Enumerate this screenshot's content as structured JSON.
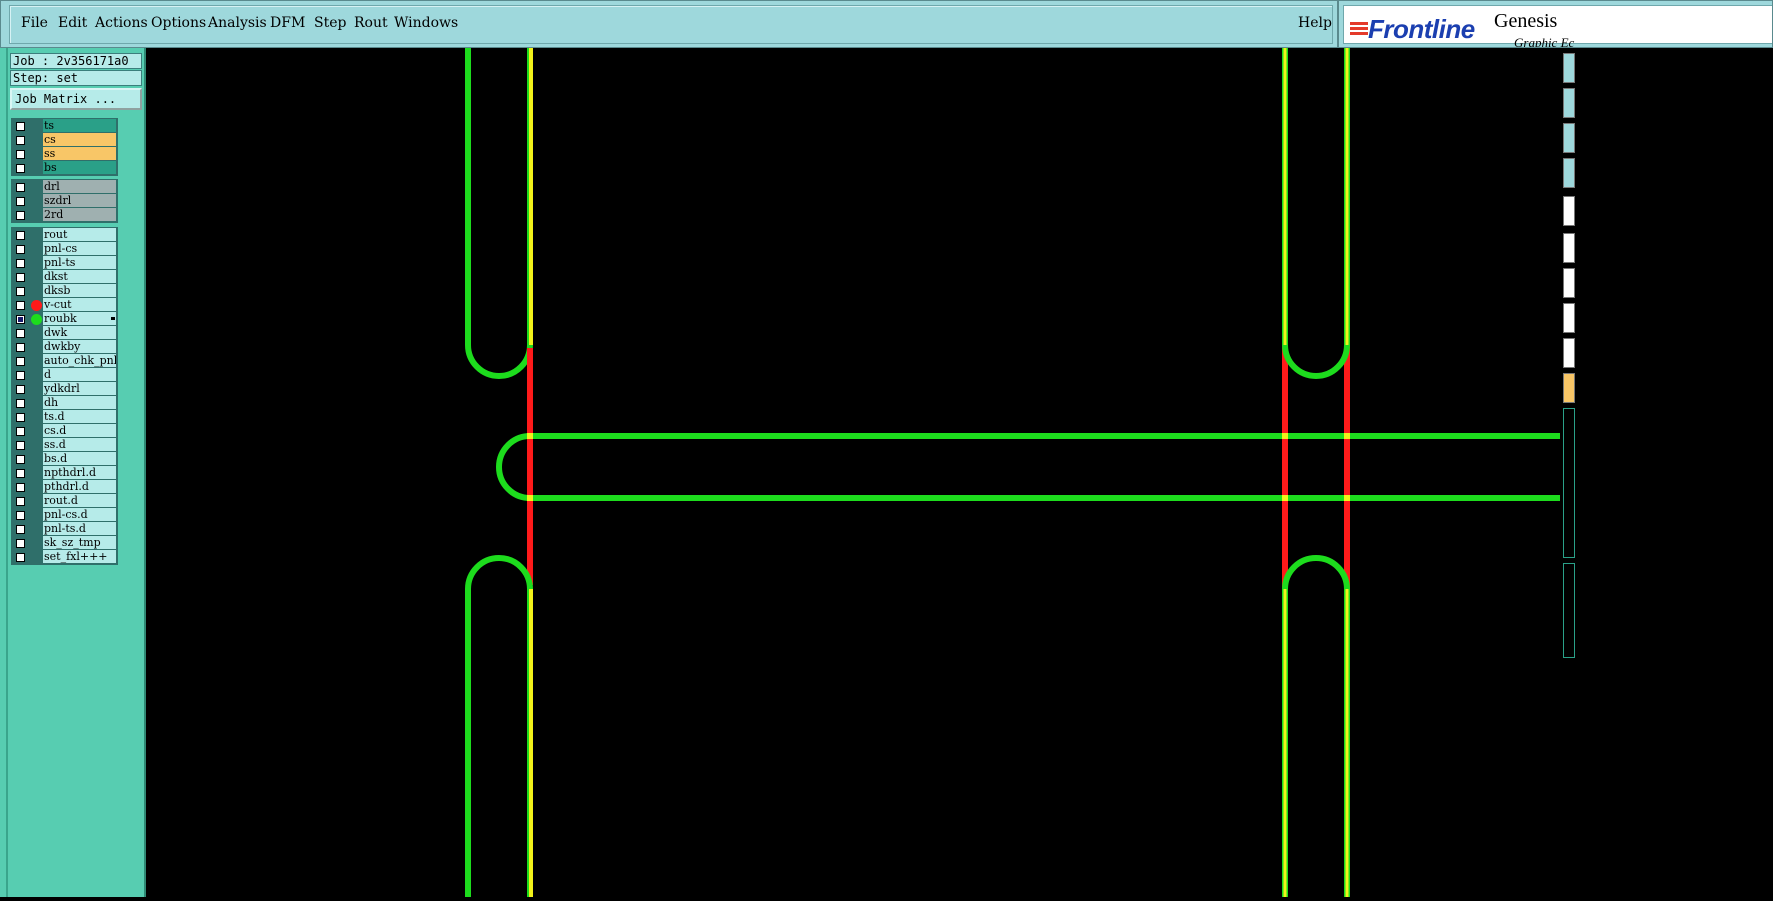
{
  "menu": {
    "items": [
      {
        "label": "File"
      },
      {
        "label": "Edit"
      },
      {
        "label": "Actions"
      },
      {
        "label": "Options"
      },
      {
        "label": "Analysis"
      },
      {
        "label": "DFM"
      },
      {
        "label": "Step"
      },
      {
        "label": "Rout"
      },
      {
        "label": "Windows"
      }
    ],
    "help_label": "Help"
  },
  "brand": {
    "logo_text": "Frontline",
    "product": "Genesis",
    "subtitle": "Graphic Ec"
  },
  "job": {
    "job_line": "Job : 2v356171a0",
    "step_line": "Step: set",
    "matrix_button": "Job Matrix ..."
  },
  "colors": {
    "panel_bg": "#57cdb1",
    "layer_board_green": "#2aa088",
    "layer_board_orange": "#f8c667",
    "layer_drill_gray": "#9fb0b0",
    "layer_other": "#b6ebe9",
    "trace_green": "#1ddc1d",
    "trace_yellow": "#f2f21a",
    "trace_red": "#ff1a1a"
  },
  "layer_groups": [
    {
      "layers": [
        {
          "name": "ts",
          "color": "#2aa088",
          "checked": false,
          "dot": null
        },
        {
          "name": "cs",
          "color": "#f8c667",
          "checked": false,
          "dot": null
        },
        {
          "name": "ss",
          "color": "#f8c667",
          "checked": false,
          "dot": null
        },
        {
          "name": "bs",
          "color": "#2aa088",
          "checked": false,
          "dot": null
        }
      ]
    },
    {
      "layers": [
        {
          "name": "drl",
          "color": "#9fb0b0",
          "checked": false,
          "dot": null
        },
        {
          "name": "szdrl",
          "color": "#9fb0b0",
          "checked": false,
          "dot": null
        },
        {
          "name": "2rd",
          "color": "#9fb0b0",
          "checked": false,
          "dot": null
        }
      ]
    },
    {
      "layers": [
        {
          "name": "rout",
          "color": "#b6ebe9",
          "checked": false,
          "dot": null
        },
        {
          "name": "pnl-cs",
          "color": "#b6ebe9",
          "checked": false,
          "dot": null
        },
        {
          "name": "pnl-ts",
          "color": "#b6ebe9",
          "checked": false,
          "dot": null
        },
        {
          "name": "dkst",
          "color": "#b6ebe9",
          "checked": false,
          "dot": null
        },
        {
          "name": "dksb",
          "color": "#b6ebe9",
          "checked": false,
          "dot": null
        },
        {
          "name": "v-cut",
          "color": "#b6ebe9",
          "checked": false,
          "dot": "#ff1a1a"
        },
        {
          "name": "roubk",
          "color": "#b6ebe9",
          "checked": true,
          "dot": "#1ddc1d",
          "marker": true
        },
        {
          "name": "dwk",
          "color": "#b6ebe9",
          "checked": false,
          "dot": null
        },
        {
          "name": "dwkby",
          "color": "#b6ebe9",
          "checked": false,
          "dot": null
        },
        {
          "name": "auto_chk_pnl",
          "color": "#b6ebe9",
          "checked": false,
          "dot": null
        },
        {
          "name": "d",
          "color": "#b6ebe9",
          "checked": false,
          "dot": null
        },
        {
          "name": "ydkdrl",
          "color": "#b6ebe9",
          "checked": false,
          "dot": null
        },
        {
          "name": "dh",
          "color": "#b6ebe9",
          "checked": false,
          "dot": null
        },
        {
          "name": "ts.d",
          "color": "#b6ebe9",
          "checked": false,
          "dot": null
        },
        {
          "name": "cs.d",
          "color": "#b6ebe9",
          "checked": false,
          "dot": null
        },
        {
          "name": "ss.d",
          "color": "#b6ebe9",
          "checked": false,
          "dot": null
        },
        {
          "name": "bs.d",
          "color": "#b6ebe9",
          "checked": false,
          "dot": null
        },
        {
          "name": "npthdrl.d",
          "color": "#b6ebe9",
          "checked": false,
          "dot": null
        },
        {
          "name": "pthdrl.d",
          "color": "#b6ebe9",
          "checked": false,
          "dot": null
        },
        {
          "name": "rout.d",
          "color": "#b6ebe9",
          "checked": false,
          "dot": null
        },
        {
          "name": "pnl-cs.d",
          "color": "#b6ebe9",
          "checked": false,
          "dot": null
        },
        {
          "name": "pnl-ts.d",
          "color": "#b6ebe9",
          "checked": false,
          "dot": null
        },
        {
          "name": "sk_sz_tmp",
          "color": "#b6ebe9",
          "checked": false,
          "dot": null
        },
        {
          "name": "set_fxl+++",
          "color": "#b6ebe9",
          "checked": false,
          "dot": null
        }
      ]
    }
  ]
}
